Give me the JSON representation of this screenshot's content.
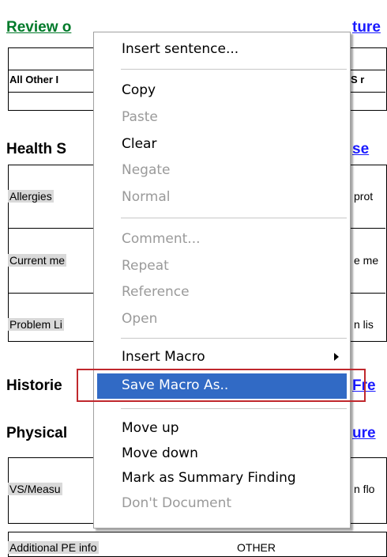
{
  "sections": {
    "review": {
      "title_left": "Review o",
      "title_right": "ture"
    },
    "review_box": {
      "label": "All Other I",
      "right": "S r"
    },
    "health": {
      "title_left": "Health S",
      "link": "se"
    },
    "rows": [
      {
        "left": "Allergies",
        "right": "prot"
      },
      {
        "left": "Current me",
        "right": "e me"
      },
      {
        "left": "Problem Li",
        "right": "n lis"
      }
    ],
    "histories": {
      "title_left": "Historie",
      "link": "Fre"
    },
    "physical": {
      "title_left": "Physical",
      "link": "ure"
    },
    "vs_row": {
      "left": "VS/Measu",
      "right": "n flo"
    },
    "bottom_row": {
      "left": "Additional PE info",
      "right": "OTHER"
    }
  },
  "menu": {
    "items": [
      {
        "label": "Insert sentence...",
        "enabled": true
      },
      {
        "label": "Copy",
        "enabled": true
      },
      {
        "label": "Paste",
        "enabled": false
      },
      {
        "label": "Clear",
        "enabled": true
      },
      {
        "label": "Negate",
        "enabled": false
      },
      {
        "label": "Normal",
        "enabled": false
      },
      {
        "label": "Comment...",
        "enabled": false
      },
      {
        "label": "Repeat",
        "enabled": false
      },
      {
        "label": "Reference",
        "enabled": false
      },
      {
        "label": "Open",
        "enabled": false
      },
      {
        "label": "Insert Macro",
        "enabled": true,
        "submenu": true
      },
      {
        "label": "Save Macro As..",
        "enabled": true,
        "highlighted": true
      },
      {
        "label": "Move up",
        "enabled": true
      },
      {
        "label": "Move down",
        "enabled": true
      },
      {
        "label": "Mark as Summary Finding",
        "enabled": true
      },
      {
        "label": "Don't Document",
        "enabled": false
      }
    ]
  },
  "colors": {
    "highlight": "#316ac5",
    "annotation_box": "#c0282d",
    "section_green": "#007a2a",
    "link_blue": "#1a1aff"
  }
}
